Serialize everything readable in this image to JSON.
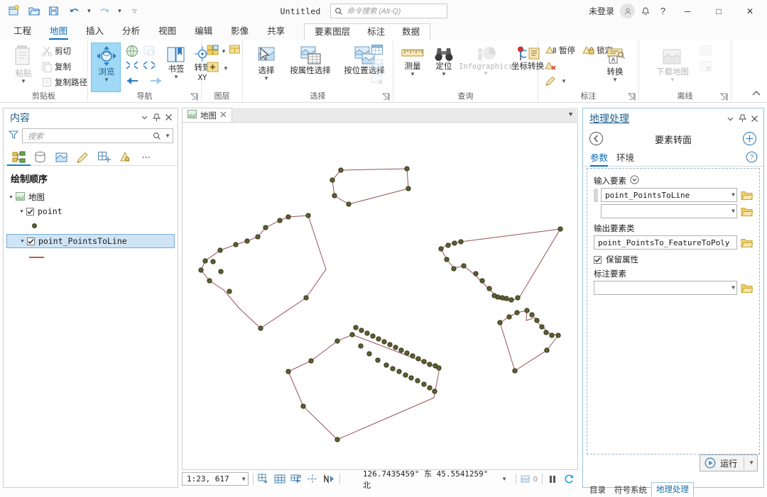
{
  "titlebar": {
    "doc_title": "Untitled",
    "search_placeholder": "命令搜索 (Alt-Q)",
    "signin_label": "未登录",
    "qat": [
      {
        "name": "new-project-icon",
        "label": "新建"
      },
      {
        "name": "open-project-icon",
        "label": "打开"
      },
      {
        "name": "save-project-icon",
        "label": "保存"
      },
      {
        "name": "undo-icon",
        "label": "撤销"
      },
      {
        "name": "redo-icon",
        "label": "重做"
      },
      {
        "name": "customize-qat-icon",
        "label": "自定义快速访问工具栏"
      }
    ],
    "window_buttons": {
      "minimize": "─",
      "maximize": "□",
      "close": "✕"
    }
  },
  "ribbon_tabs": {
    "main": [
      {
        "label": "工程",
        "active": false
      },
      {
        "label": "地图",
        "active": true
      },
      {
        "label": "插入",
        "active": false
      },
      {
        "label": "分析",
        "active": false
      },
      {
        "label": "视图",
        "active": false
      },
      {
        "label": "编辑",
        "active": false
      },
      {
        "label": "影像",
        "active": false
      },
      {
        "label": "共享",
        "active": false
      }
    ],
    "contextual": [
      {
        "label": "要素图层",
        "active": false
      },
      {
        "label": "标注",
        "active": false
      },
      {
        "label": "数据",
        "active": false
      }
    ]
  },
  "ribbon": {
    "groups": [
      {
        "name": "clipboard",
        "label": "剪贴板",
        "paste_label": "粘贴",
        "items": [
          {
            "label": "剪切",
            "icon": "scissors-icon"
          },
          {
            "label": "复制",
            "icon": "copy-icon"
          },
          {
            "label": "复制路径",
            "icon": "copy-path-icon"
          }
        ]
      },
      {
        "name": "navigate",
        "label": "导航",
        "explore_label": "浏览",
        "bookmarks_label": "书签",
        "goto_xy_label": "转到\nXY",
        "goto_xy_line1": "转到",
        "goto_xy_line2": "XY"
      },
      {
        "name": "layer",
        "label": "图层"
      },
      {
        "name": "selection",
        "label": "选择",
        "items": [
          {
            "label": "选择",
            "icon": "select-icon"
          },
          {
            "label": "按属性选择",
            "icon": "select-by-attribute-icon"
          },
          {
            "label": "按位置选择",
            "icon": "select-by-location-icon"
          }
        ]
      },
      {
        "name": "inquiry",
        "label": "查询",
        "items": [
          {
            "label": "测量",
            "icon": "measure-icon"
          },
          {
            "label": "定位",
            "icon": "locate-icon"
          },
          {
            "label": "Infographics",
            "icon": "infographics-icon",
            "disabled": true
          },
          {
            "label": "坐标转换",
            "icon": "convert-coordinates-icon"
          }
        ]
      },
      {
        "name": "labeling",
        "label": "标注",
        "items": [
          {
            "label": "暂停",
            "icon": "pause-labeling-icon"
          },
          {
            "label": "锁定",
            "icon": "lock-labeling-icon"
          }
        ],
        "convert_label": "转换"
      },
      {
        "name": "offline",
        "label": "离线",
        "download_map_label": "下载地图"
      }
    ]
  },
  "contents_panel": {
    "title": "内容",
    "search_placeholder": "搜索",
    "toc_tabs": [
      {
        "name": "drawing-order-tab",
        "active": true
      },
      {
        "name": "data-source-tab",
        "active": false
      },
      {
        "name": "selection-tab",
        "active": false
      },
      {
        "name": "editing-tab",
        "active": false
      },
      {
        "name": "snapping-tab",
        "active": false
      },
      {
        "name": "labeling-tab",
        "active": false
      },
      {
        "name": "more-tab",
        "active": false
      }
    ],
    "heading": "绘制顺序",
    "tree": [
      {
        "label": "地图",
        "level": 0,
        "type": "map",
        "checked": null,
        "expanded": true,
        "selected": false
      },
      {
        "label": "point",
        "level": 1,
        "type": "layer",
        "checked": true,
        "expanded": true,
        "selected": false
      },
      {
        "label": "",
        "level": 2,
        "type": "symbol-point",
        "checked": null,
        "expanded": false,
        "selected": false
      },
      {
        "label": "point_PointsToLine",
        "level": 1,
        "type": "layer",
        "checked": true,
        "expanded": true,
        "selected": true
      },
      {
        "label": "",
        "level": 2,
        "type": "symbol-line",
        "checked": null,
        "expanded": false,
        "selected": false
      }
    ]
  },
  "map": {
    "tab_label": "地图",
    "scale": "1:23, 617",
    "coordinates": "126.7435459° 东  45.5541259° 北",
    "selection_count": "0",
    "statusbar_icons": [
      {
        "name": "add-data-icon"
      },
      {
        "name": "basemap-grid-icon"
      },
      {
        "name": "snapping-icon"
      },
      {
        "name": "show-hide-icon"
      },
      {
        "name": "measure-direction-icon"
      }
    ],
    "line_color": "#9c4f57",
    "vertex_fill": "#5c5f2e",
    "vertex_stroke": "#30331a"
  },
  "geoprocessing_panel": {
    "title": "地理处理",
    "tool_name": "要素转面",
    "tabs": [
      {
        "label": "参数",
        "active": true
      },
      {
        "label": "环境",
        "active": false
      }
    ],
    "fields": {
      "input_features_label": "输入要素",
      "input_features_value": "point_PointsToLine",
      "input_features_value2": "",
      "output_feature_class_label": "输出要素类",
      "output_feature_class_value": "point_PointsTo_FeatureToPoly",
      "preserve_attributes_label": "保留属性",
      "preserve_attributes_checked": true,
      "label_features_label": "标注要素",
      "label_features_value": ""
    },
    "run_label": "运行"
  },
  "bottom_tabs": [
    {
      "label": "目录",
      "active": false
    },
    {
      "label": "符号系统",
      "active": false
    },
    {
      "label": "地理处理",
      "active": true
    }
  ],
  "chart_data": {
    "type": "scatter",
    "title": "",
    "polygons": [
      {
        "id": "poly-1",
        "points": "[[467,253],[478,239],[570,237],[574,265],[490,287],[470,275],[467,253]]"
      },
      {
        "id": "poly-2",
        "points": "[[282,381],[288,368],[308,354],[331,345],[347,340],[362,333],[372,320],[393,310],[404,305],[432,304],[447,330],[458,380],[430,420],[364,462],[336,434],[313,408],[294,395],[282,381]]"
      },
      {
        "id": "poly-3",
        "points": "[[405,524],[437,509],[474,481],[494,472],[512,497],[528,515],[547,526],[566,534],[578,540],[590,546],[601,554],[614,560],[620,520],[614,516],[606,515],[583,506],[560,495],[540,486],[527,478],[520,470],[511,455],[474,620],[424,570],[405,524]]"
      },
      {
        "id": "poly-4",
        "points": "[[648,345],[627,350],[620,366],[648,340],[675,386],[688,405],[700,425],[714,421],[728,420],[745,412],[762,396],[788,323],[648,345]]"
      },
      {
        "id": "poly-5",
        "points": "[[703,455],[715,447],[726,440],[740,437],[752,448],[763,458],[772,470],[784,472],[771,495],[724,522],[703,455]]"
      }
    ]
  }
}
